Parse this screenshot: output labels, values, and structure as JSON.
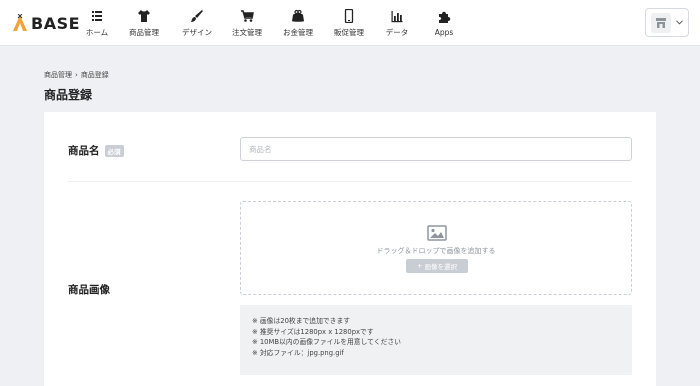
{
  "logo": {
    "text": "BASE"
  },
  "nav": [
    {
      "label": "ホーム",
      "icon": "list-icon"
    },
    {
      "label": "商品管理",
      "icon": "tshirt-icon"
    },
    {
      "label": "デザイン",
      "icon": "brush-icon"
    },
    {
      "label": "注文管理",
      "icon": "cart-icon"
    },
    {
      "label": "お金管理",
      "icon": "purse-icon"
    },
    {
      "label": "販促管理",
      "icon": "phone-icon"
    },
    {
      "label": "データ",
      "icon": "bar-chart-icon"
    },
    {
      "label": "Apps",
      "icon": "puzzle-icon"
    }
  ],
  "breadcrumb": {
    "parent": "商品管理",
    "separator": "›",
    "current": "商品登録"
  },
  "page": {
    "title": "商品登録"
  },
  "form": {
    "name_label": "商品名",
    "required_badge": "必須",
    "name_placeholder": "商品名",
    "name_value": "",
    "image_label": "商品画像",
    "dropzone_text": "ドラッグ＆ドロップで画像を追加する",
    "select_button": "画像を選択",
    "select_button_prefix": "+",
    "notes": [
      "※ 画像は20枚まで追加できます",
      "※ 推奨サイズは1280px x 1280pxです",
      "※ 10MB以内の画像ファイルを用意してください",
      "※ 対応ファイル：jpg.png.gif"
    ]
  },
  "colors": {
    "accent": "#f2a33a",
    "badge": "#c9ced5",
    "background": "#eef0f3"
  }
}
